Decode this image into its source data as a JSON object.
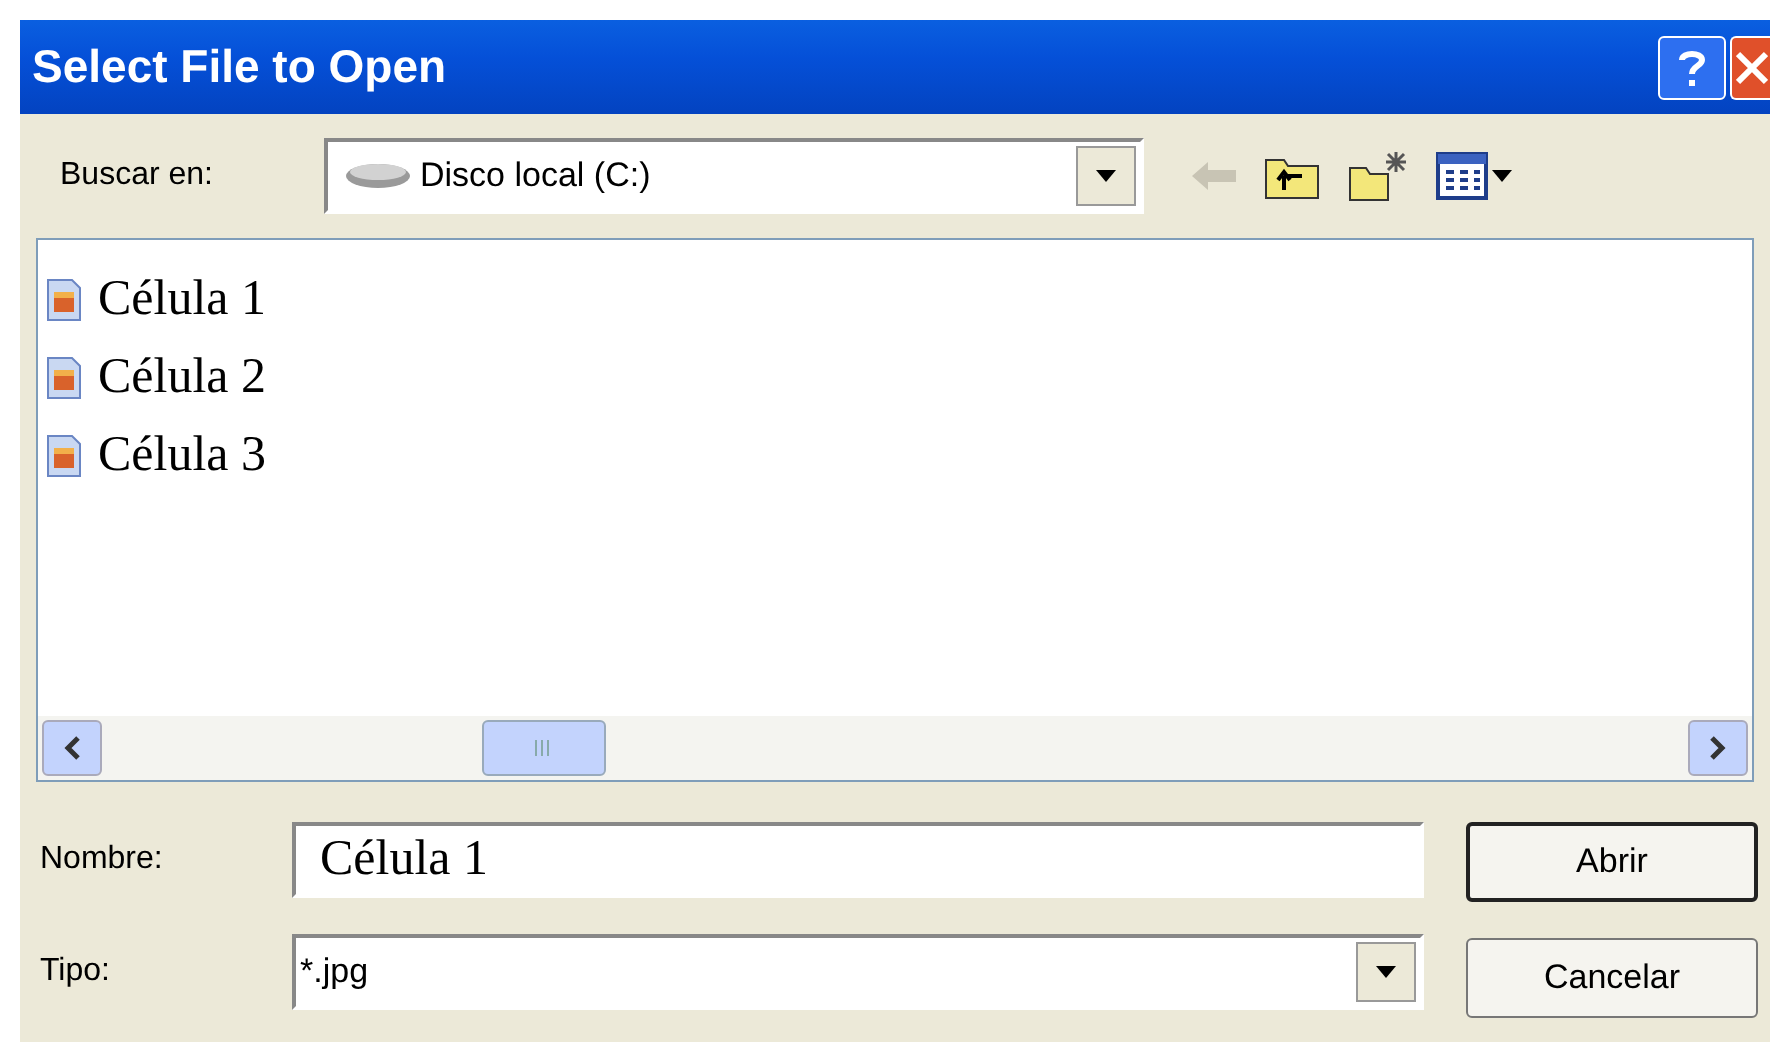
{
  "window": {
    "title": "Select File to Open"
  },
  "look_in": {
    "label": "Buscar en:",
    "value": "Disco local (C:)"
  },
  "files": [
    {
      "name": "Célula 1"
    },
    {
      "name": "Célula 2"
    },
    {
      "name": "Célula 3"
    }
  ],
  "file_name": {
    "label": "Nombre:",
    "value": "Célula 1"
  },
  "file_type": {
    "label": "Tipo:",
    "value": "*.jpg"
  },
  "buttons": [
    {
      "label": "Abrir",
      "kind": "default"
    },
    {
      "label": "Cancelar",
      "kind": "normal"
    }
  ]
}
